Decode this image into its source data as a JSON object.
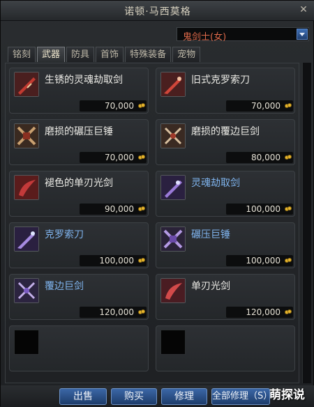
{
  "window": {
    "title": "诺顿·马西莫格"
  },
  "class_select": {
    "value": "鬼剑士(女)"
  },
  "tabs": [
    "铭刻",
    "武器",
    "防具",
    "首饰",
    "特殊装备",
    "宠物"
  ],
  "active_tab": "武器",
  "items": [
    {
      "name": "生锈的灵魂劫取剑",
      "price": "70,000",
      "name_color": "white",
      "icon": "red-sword-icon"
    },
    {
      "name": "旧式克罗索刀",
      "price": "70,000",
      "name_color": "white",
      "icon": "red-blade-icon"
    },
    {
      "name": "磨损的碾压巨锤",
      "price": "70,000",
      "name_color": "white",
      "icon": "crossed-hammer-icon"
    },
    {
      "name": "磨损的覆边巨剑",
      "price": "80,000",
      "name_color": "white",
      "icon": "crossed-greatsword-icon"
    },
    {
      "name": "褪色的单刃光剑",
      "price": "90,000",
      "name_color": "white",
      "icon": "red-lightsword-icon"
    },
    {
      "name": "灵魂劫取剑",
      "price": "100,000",
      "name_color": "blue",
      "icon": "purple-sword-icon"
    },
    {
      "name": "克罗索刀",
      "price": "100,000",
      "name_color": "blue",
      "icon": "purple-blade-icon"
    },
    {
      "name": "碾压巨锤",
      "price": "100,000",
      "name_color": "blue",
      "icon": "purple-hammer-icon"
    },
    {
      "name": "覆边巨剑",
      "price": "120,000",
      "name_color": "blue",
      "icon": "purple-greatsword-icon"
    },
    {
      "name": "单刃光剑",
      "price": "120,000",
      "name_color": "white",
      "icon": "red-lightsword-icon"
    }
  ],
  "buttons": {
    "sell": "出售",
    "buy": "购买",
    "repair": "修理",
    "repair_all": "全部修理（S）"
  },
  "watermark": "萌探说",
  "colors": {
    "blue_name": "#7fb4ee",
    "white_name": "#ecebe6",
    "button_blue": "#3b67a6",
    "class_red": "#e06a4a"
  }
}
